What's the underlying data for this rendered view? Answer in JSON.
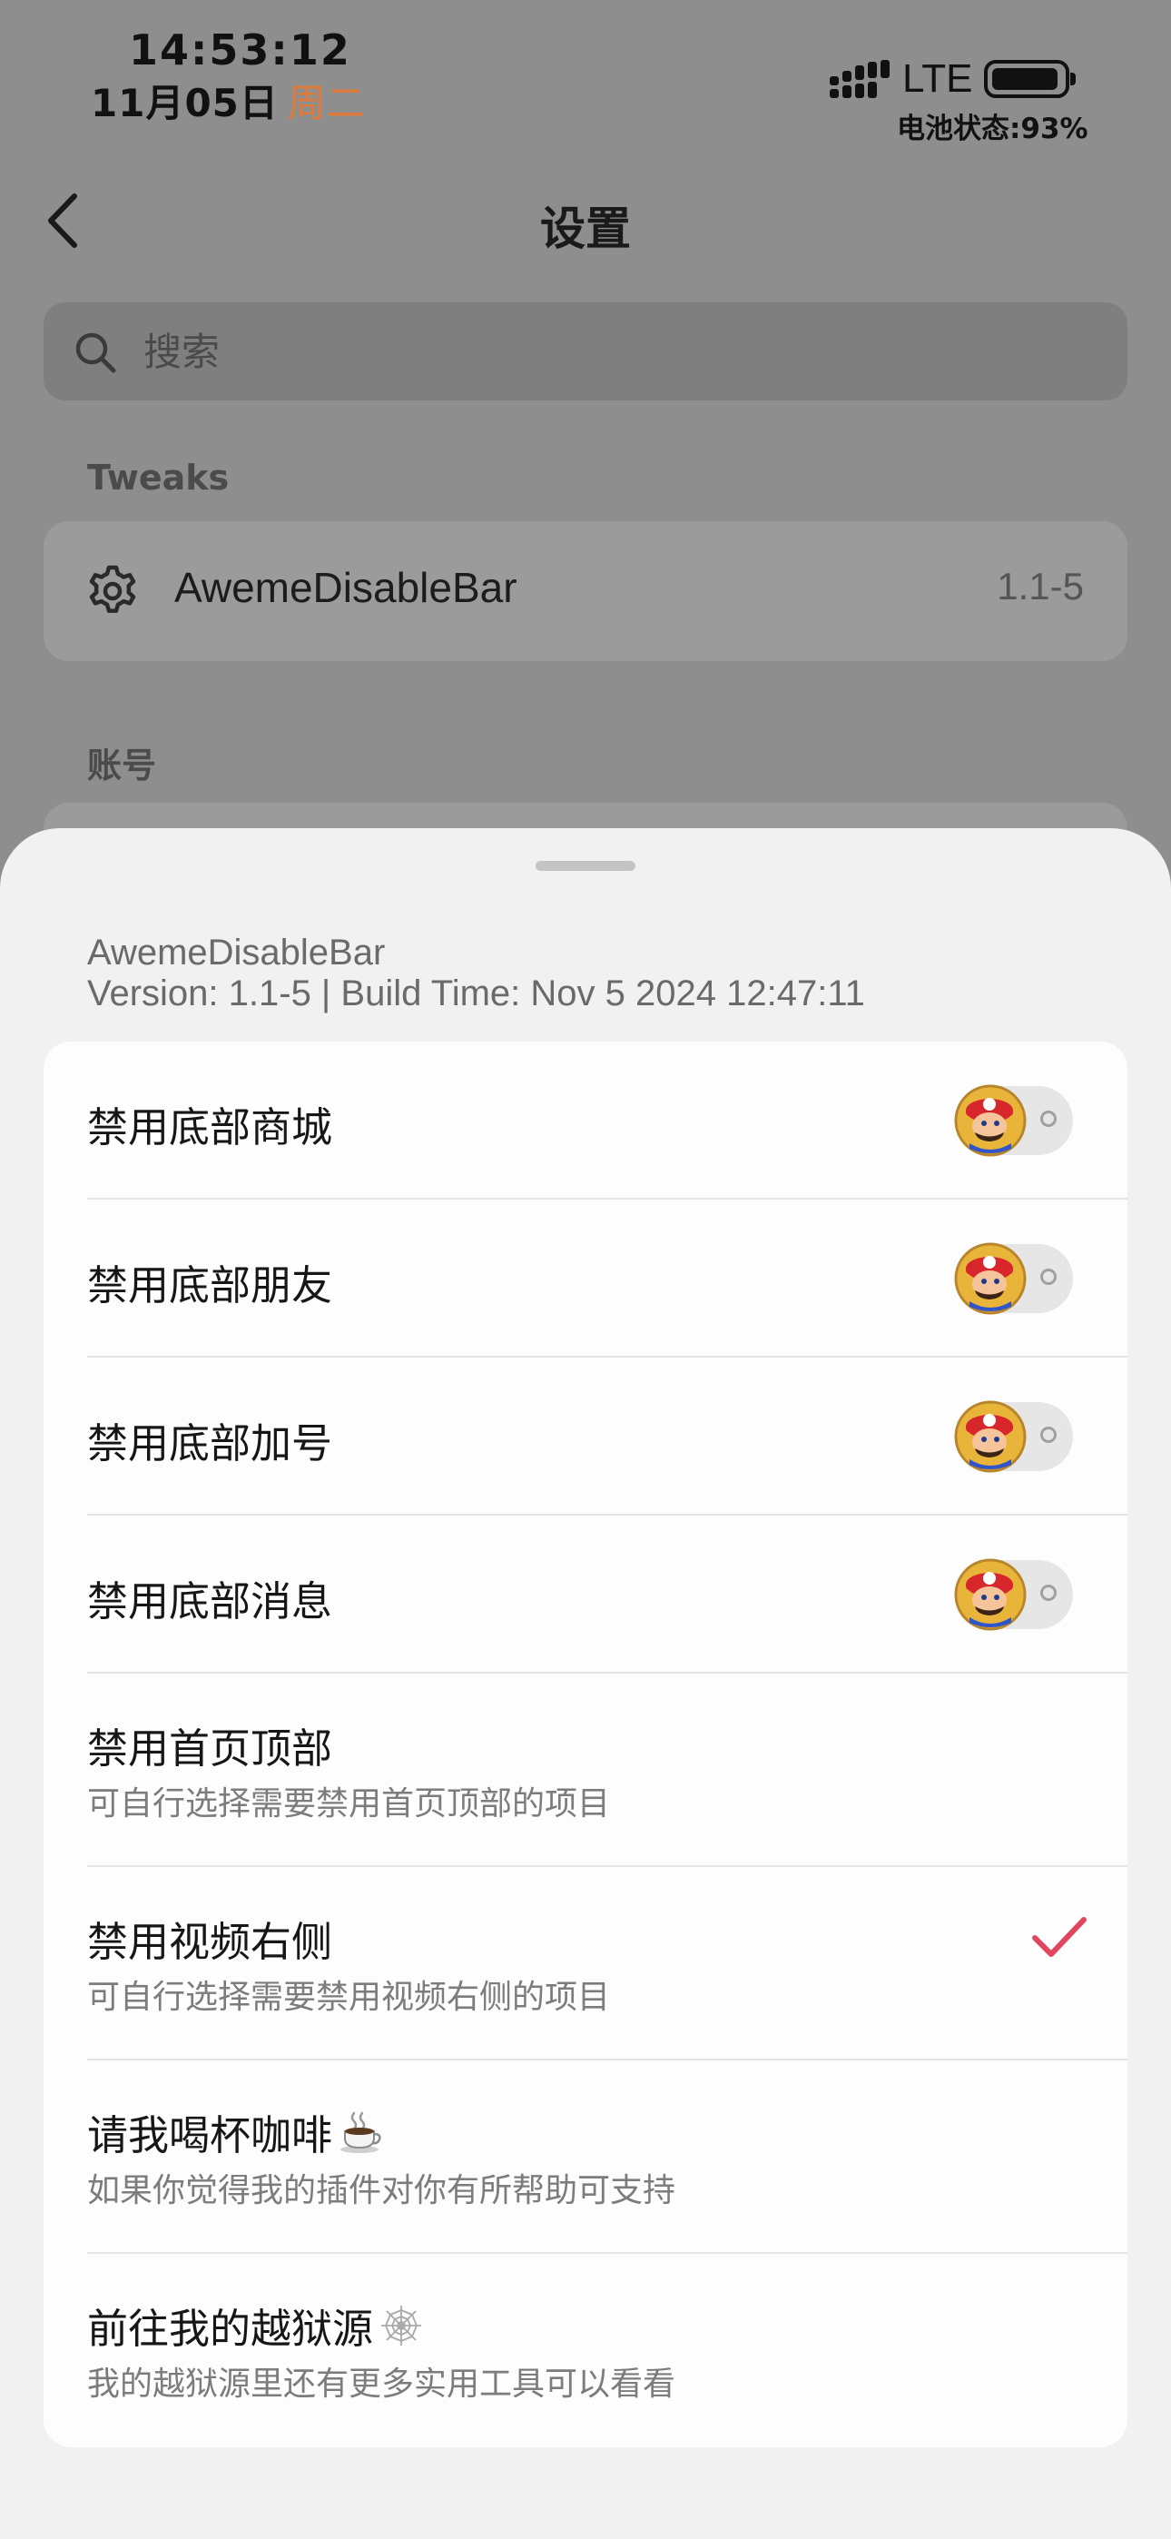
{
  "status_bar": {
    "time": "14:53:12",
    "date": "11月05日",
    "weekday": "周二",
    "network": "LTE",
    "battery_text": "电池状态:93%",
    "battery_level": 0.93
  },
  "nav": {
    "title": "设置"
  },
  "search": {
    "placeholder": "搜索"
  },
  "sections": {
    "tweaks_header": "Tweaks",
    "account_header": "账号"
  },
  "tweak_item": {
    "name": "AwemeDisableBar",
    "version": "1.1-5"
  },
  "sheet": {
    "app_name": "AwemeDisableBar",
    "build_info": "Version: 1.1-5 | Build Time: Nov  5 2024 12:47:11",
    "rows": [
      {
        "title": "禁用底部商城",
        "control": "toggle",
        "on": false
      },
      {
        "title": "禁用底部朋友",
        "control": "toggle",
        "on": false
      },
      {
        "title": "禁用底部加号",
        "control": "toggle",
        "on": false
      },
      {
        "title": "禁用底部消息",
        "control": "toggle",
        "on": false
      },
      {
        "title": "禁用首页顶部",
        "subtitle": "可自行选择需要禁用首页顶部的项目"
      },
      {
        "title": "禁用视频右侧",
        "subtitle": "可自行选择需要禁用视频右侧的项目",
        "checked": true
      },
      {
        "title": "请我喝杯咖啡",
        "subtitle": "如果你觉得我的插件对你有所帮助可支持",
        "icon": "coffee-icon"
      },
      {
        "title": "前往我的越狱源",
        "subtitle": "我的越狱源里还有更多实用工具可以看看",
        "icon": "spiderweb-icon"
      }
    ]
  },
  "colors": {
    "dim_background": "#8e8e8e",
    "sheet_background": "#f1f1f1",
    "weekday_accent": "#e07a3a",
    "checkmark": "#e0475f"
  }
}
